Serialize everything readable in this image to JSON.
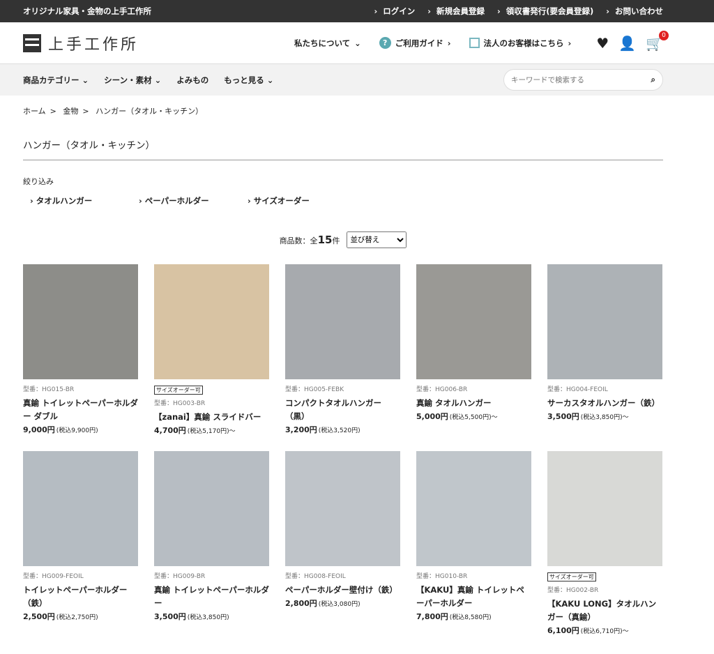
{
  "topbar": {
    "tagline": "オリジナル家具・金物の上手工作所",
    "links": [
      "ログイン",
      "新規会員登録",
      "領収書発行(要会員登録)",
      "お問い合わせ"
    ]
  },
  "header": {
    "logo_text": "上手工作所",
    "nav": [
      "私たちについて",
      "ご利用ガイド",
      "法人のお客様はこちら"
    ],
    "cart_count": "0"
  },
  "subnav": {
    "items": [
      "商品カテゴリー",
      "シーン・素材",
      "よみもの",
      "もっと見る"
    ],
    "search_placeholder": "キーワードで検索する"
  },
  "breadcrumb": [
    "ホーム",
    "金物",
    "ハンガー（タオル・キッチン）"
  ],
  "page_title": "ハンガー（タオル・キッチン）",
  "filter": {
    "label": "絞り込み",
    "options": [
      "タオルハンガー",
      "ペーパーホルダー",
      "サイズオーダー"
    ]
  },
  "sort": {
    "count_prefix": "商品数：全",
    "count": "15",
    "count_suffix": "件",
    "select": "並び替え"
  },
  "products": [
    {
      "tag": "",
      "code": "型番：HG015-BR",
      "name": "真鍮 トイレットペーパーホルダー ダブル",
      "price": "9,000円",
      "tax": "(税込9,900円)",
      "img": "#8d8d89"
    },
    {
      "tag": "サイズオーダー可",
      "code": "型番：HG003-BR",
      "name": "【zanai】真鍮 スライドバー",
      "price": "4,700円",
      "tax": "(税込5,170円)〜",
      "img": "#d8c3a3"
    },
    {
      "tag": "",
      "code": "型番：HG005-FEBK",
      "name": "コンパクトタオルハンガー（黒）",
      "price": "3,200円",
      "tax": "(税込3,520円)",
      "img": "#a7aaae"
    },
    {
      "tag": "",
      "code": "型番：HG006-BR",
      "name": "真鍮 タオルハンガー",
      "price": "5,000円",
      "tax": "(税込5,500円)〜",
      "img": "#9a9995"
    },
    {
      "tag": "",
      "code": "型番：HG004-FEOIL",
      "name": "サーカスタオルハンガー（鉄）",
      "price": "3,500円",
      "tax": "(税込3,850円)〜",
      "img": "#adb2b6"
    },
    {
      "tag": "",
      "code": "型番：HG009-FEOIL",
      "name": "トイレットペーパーホルダー（鉄）",
      "price": "2,500円",
      "tax": "(税込2,750円)",
      "img": "#b5bcc2"
    },
    {
      "tag": "",
      "code": "型番：HG009-BR",
      "name": "真鍮 トイレットペーパーホルダー",
      "price": "3,500円",
      "tax": "(税込3,850円)",
      "img": "#b7bdc3"
    },
    {
      "tag": "",
      "code": "型番：HG008-FEOIL",
      "name": "ペーパーホルダー壁付け（鉄）",
      "price": "2,800円",
      "tax": "(税込3,080円)",
      "img": "#bfc4c9"
    },
    {
      "tag": "",
      "code": "型番：HG010-BR",
      "name": "【KAKU】真鍮 トイレットペーパーホルダー",
      "price": "7,800円",
      "tax": "(税込8,580円)",
      "img": "#c0c6cb"
    },
    {
      "tag": "サイズオーダー可",
      "code": "型番：HG002-BR",
      "name": "【KAKU LONG】タオルハンガー（真鍮）",
      "price": "6,100円",
      "tax": "(税込6,710円)〜",
      "img": "#d8d9d6"
    }
  ]
}
